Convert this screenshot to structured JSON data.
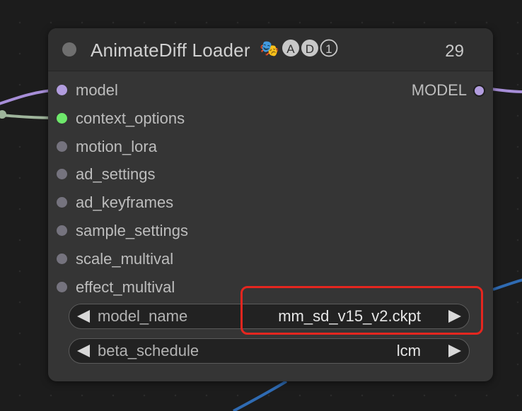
{
  "node": {
    "title": "AnimateDiff Loader",
    "title_badge_emoji": "🎭",
    "title_badge_letters": [
      "A",
      "D",
      "1"
    ],
    "id": "29"
  },
  "inputs": [
    {
      "label": "model",
      "color": "#b29ddf"
    },
    {
      "label": "context_options",
      "color": "#6ee86b"
    },
    {
      "label": "motion_lora",
      "color": "#75737e"
    },
    {
      "label": "ad_settings",
      "color": "#75737e"
    },
    {
      "label": "ad_keyframes",
      "color": "#75737e"
    },
    {
      "label": "sample_settings",
      "color": "#75737e"
    },
    {
      "label": "scale_multival",
      "color": "#75737e"
    },
    {
      "label": "effect_multival",
      "color": "#75737e"
    }
  ],
  "outputs": [
    {
      "label": "MODEL",
      "color": "#b29ddf"
    }
  ],
  "widgets": [
    {
      "label": "model_name",
      "value": "mm_sd_v15_v2.ckpt"
    },
    {
      "label": "beta_schedule",
      "value": "lcm"
    }
  ],
  "colors": {
    "highlight": "#e5261f",
    "wire_model": "#a78ed8",
    "wire_context": "#9fb59c",
    "wire_blue": "#2f6bb3"
  }
}
